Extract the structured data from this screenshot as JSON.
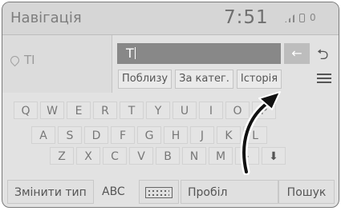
{
  "header": {
    "title": "Навігація",
    "time": "7:51",
    "status_icons": [
      "signal-icon",
      "phone-icon",
      "zero-status"
    ],
    "status_zero": "0"
  },
  "location": {
    "icon": "pin-icon",
    "text": "ТІ"
  },
  "search": {
    "value": "Т",
    "backspace_icon": "arrow-left-icon",
    "back_icon": "return-icon"
  },
  "tabs": [
    "Поблизу",
    "За катег.",
    "Історія"
  ],
  "menu_icon": "list-icon",
  "keyboard": {
    "row1": [
      "Q",
      "W",
      "E",
      "R",
      "T",
      "Y",
      "U",
      "I",
      "O",
      "P"
    ],
    "row2": [
      "A",
      "S",
      "D",
      "F",
      "G",
      "H",
      "J",
      "K",
      "L"
    ],
    "row3": [
      "Z",
      "X",
      "C",
      "V",
      "B",
      "N",
      "M",
      "-",
      "⬇"
    ]
  },
  "bottom": {
    "change_type": "Змінити тип",
    "abc": "ABC",
    "space": "Пробіл",
    "search": "Пошук"
  },
  "colors": {
    "header_bg": "#d6d6d6",
    "input_bg": "#888888",
    "key_text": "#777777"
  }
}
